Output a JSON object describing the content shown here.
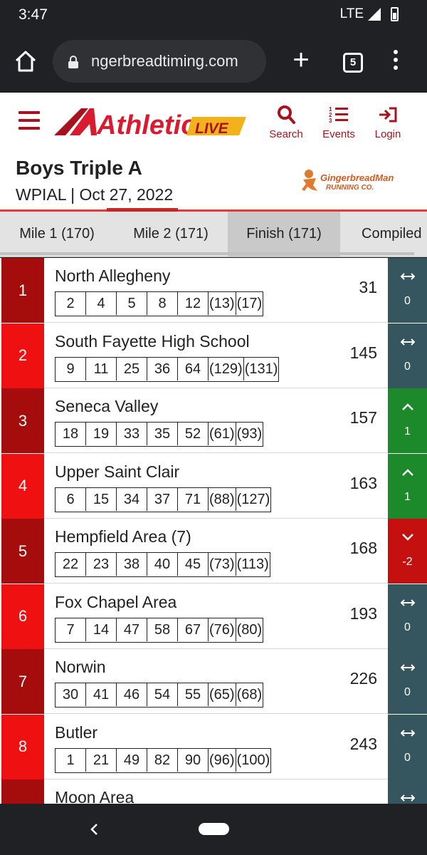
{
  "status_bar": {
    "time": "3:47",
    "network": "LTE"
  },
  "browser": {
    "url": "ngerbreadtiming.com",
    "tab_count": "5"
  },
  "site": {
    "logo_main": "Athletic",
    "logo_badge": "LIVE",
    "nav": {
      "search": "Search",
      "events": "Events",
      "login": "Login"
    }
  },
  "meet": {
    "title": "Boys Triple A",
    "subtitle": "WPIAL | Oct 27, 2022",
    "sponsor_line1": "GingerbreadMan",
    "sponsor_line2": "RUNNING CO."
  },
  "tabs": [
    {
      "label": "Mile 1 (170)",
      "active": false
    },
    {
      "label": "Mile 2 (171)",
      "active": false
    },
    {
      "label": "Finish (171)",
      "active": true
    },
    {
      "label": "Compiled",
      "active": false
    }
  ],
  "colors": {
    "brand_red": "#a8121e",
    "place_dark": "#a50d0d",
    "place_bright": "#ef1111",
    "move_same": "#35555f",
    "move_up": "#1c8a2a",
    "move_down": "#c51010"
  },
  "results": [
    {
      "place": "1",
      "team": "North Allegheny",
      "scorers": [
        "2",
        "4",
        "5",
        "8",
        "12",
        "(13)",
        "(17)"
      ],
      "points": "31",
      "move_icon": "left-right-arrow-icon",
      "move": "0"
    },
    {
      "place": "2",
      "team": "South Fayette High School",
      "scorers": [
        "9",
        "11",
        "25",
        "36",
        "64",
        "(129)",
        "(131)"
      ],
      "points": "145",
      "move_icon": "left-right-arrow-icon",
      "move": "0"
    },
    {
      "place": "3",
      "team": "Seneca Valley",
      "scorers": [
        "18",
        "19",
        "33",
        "35",
        "52",
        "(61)",
        "(93)"
      ],
      "points": "157",
      "move_icon": "chevron-up-icon",
      "move": "1"
    },
    {
      "place": "4",
      "team": "Upper Saint Clair",
      "scorers": [
        "6",
        "15",
        "34",
        "37",
        "71",
        "(88)",
        "(127)"
      ],
      "points": "163",
      "move_icon": "chevron-up-icon",
      "move": "1"
    },
    {
      "place": "5",
      "team": "Hempfield Area (7)",
      "scorers": [
        "22",
        "23",
        "38",
        "40",
        "45",
        "(73)",
        "(113)"
      ],
      "points": "168",
      "move_icon": "chevron-down-icon",
      "move": "-2"
    },
    {
      "place": "6",
      "team": "Fox Chapel Area",
      "scorers": [
        "7",
        "14",
        "47",
        "58",
        "67",
        "(76)",
        "(80)"
      ],
      "points": "193",
      "move_icon": "left-right-arrow-icon",
      "move": "0"
    },
    {
      "place": "7",
      "team": "Norwin",
      "scorers": [
        "30",
        "41",
        "46",
        "54",
        "55",
        "(65)",
        "(68)"
      ],
      "points": "226",
      "move_icon": "left-right-arrow-icon",
      "move": "0"
    },
    {
      "place": "8",
      "team": "Butler",
      "scorers": [
        "1",
        "21",
        "49",
        "82",
        "90",
        "(96)",
        "(100)"
      ],
      "points": "243",
      "move_icon": "left-right-arrow-icon",
      "move": "0"
    },
    {
      "place": "",
      "team": "Moon Area",
      "scorers": [],
      "points": "",
      "move_icon": "left-right-arrow-icon",
      "move": ""
    }
  ]
}
